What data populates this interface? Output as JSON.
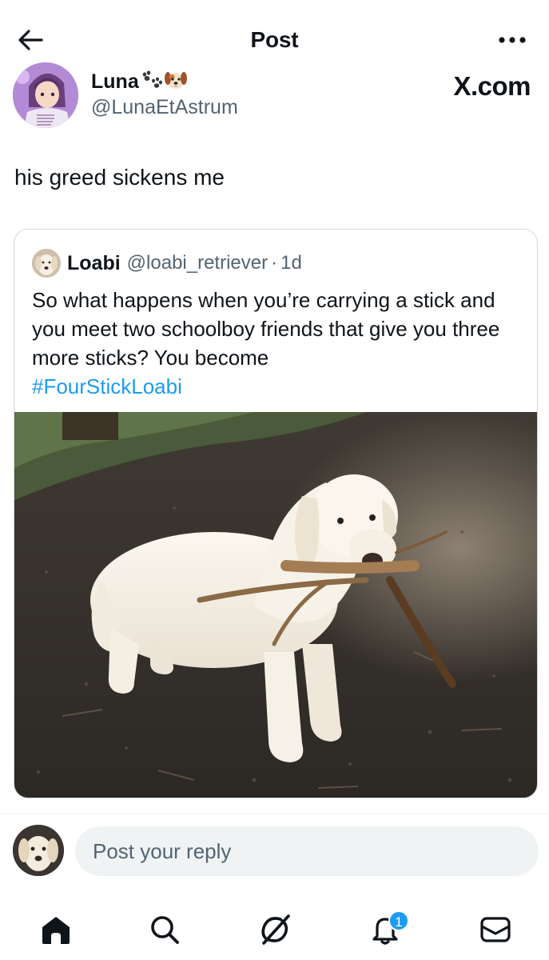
{
  "header": {
    "title": "Post"
  },
  "post": {
    "author_name": "Luna",
    "author_handle": "@LunaEtAstrum",
    "author_badges": [
      "paw-prints-emoji",
      "dog-face-emoji"
    ],
    "text": "his greed sickens me",
    "watermark": "X.com"
  },
  "quote": {
    "author_name": "Loabi",
    "author_handle": "@loabi_retriever",
    "separator": "·",
    "time": "1d",
    "text": "So what happens when you’re carrying a stick and you meet two schoolboy friends that give you three more sticks?  You become",
    "hashtag": "#FourStickLoabi",
    "media_icon": "golden-retriever-with-sticks-photo"
  },
  "reply": {
    "placeholder": "Post your reply"
  },
  "nav": {
    "items": [
      {
        "name": "home",
        "icon": "home-icon",
        "active": true
      },
      {
        "name": "search",
        "icon": "search-icon",
        "active": false
      },
      {
        "name": "grok",
        "icon": "grok-icon",
        "active": false
      },
      {
        "name": "notifications",
        "icon": "bell-icon",
        "active": false,
        "badge": "1"
      },
      {
        "name": "messages",
        "icon": "mail-icon",
        "active": false
      }
    ]
  },
  "colors": {
    "accent": "#1d9bf0",
    "text": "#0f1419",
    "secondary": "#536471",
    "border": "#cfd9de"
  }
}
